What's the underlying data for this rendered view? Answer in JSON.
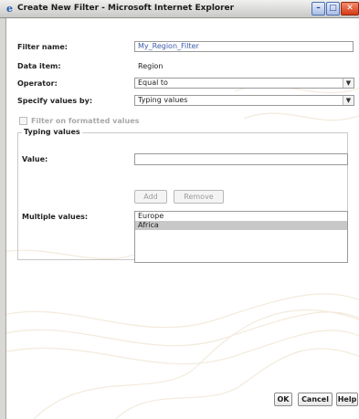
{
  "window": {
    "title": "Create New Filter - Microsoft Internet Explorer",
    "minimize": "–",
    "maximize": "□",
    "close": "✕"
  },
  "form": {
    "filter_name_label": "Filter name:",
    "filter_name_value": "My_Region_Filter",
    "data_item_label": "Data item:",
    "data_item_value": "Region",
    "operator_label": "Operator:",
    "operator_value": "Equal to",
    "specify_label": "Specify values by:",
    "specify_value": "Typing values",
    "formatted_label": "Filter on formatted values"
  },
  "typing_group": {
    "legend": "Typing values",
    "value_label": "Value:",
    "value_input": "",
    "add_label": "Add",
    "remove_label": "Remove",
    "multiple_label": "Multiple values:",
    "items": [
      {
        "label": "Europe",
        "selected": false
      },
      {
        "label": "Africa",
        "selected": true
      }
    ]
  },
  "footer": {
    "ok_label": "OK",
    "cancel_label": "Cancel",
    "help_label": "Help"
  }
}
